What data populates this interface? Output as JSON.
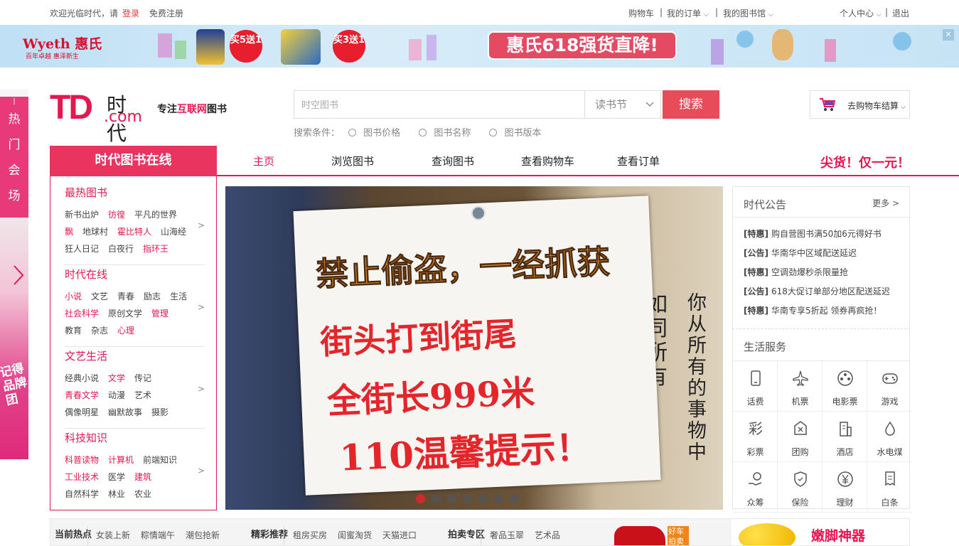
{
  "topbar": {
    "welcome": "欢迎光临时代，请",
    "login": "登录",
    "register": "免费注册",
    "cart": "购物车",
    "orders": "我的订单",
    "library": "我的图书馆",
    "user_center": "个人中心",
    "logout": "退出"
  },
  "banner": {
    "brand": "Wyeth 惠氏",
    "brand_sub": "百年卓越 惠泽新生",
    "promo1": "买5送1",
    "promo2": "买3送1",
    "slogan": "惠氏618强货直降!",
    "close": "✕"
  },
  "logo": {
    "td": "TD",
    "shidai": "时代",
    "com": ".com",
    "tag_prefix": "专注",
    "tag_highlight": "互联网",
    "tag_suffix": "图书"
  },
  "search": {
    "placeholder": "时空图书",
    "select_value": "读书节",
    "button": "搜索",
    "conditions_label": "搜索条件：",
    "options": [
      "图书价格",
      "图书名称",
      "图书版本"
    ]
  },
  "cart_button": {
    "label": "去购物车结算"
  },
  "ribbon": {
    "words": [
      "热",
      "门",
      "会",
      "场"
    ],
    "promo": "记得 品牌团"
  },
  "nav": {
    "header": "时代图书在线",
    "items": [
      "主页",
      "浏览图书",
      "查询图书",
      "查看购物车",
      "查看订单"
    ],
    "hot": "尖货！仅一元！"
  },
  "categories": [
    {
      "title": "最热图书",
      "rows": [
        [
          {
            "t": "新书出炉",
            "red": false
          },
          {
            "t": "彷徨",
            "red": true
          },
          {
            "t": "平凡的世界",
            "red": false
          }
        ],
        [
          {
            "t": "飘",
            "red": true
          },
          {
            "t": "地球村",
            "red": false
          },
          {
            "t": "霍比特人",
            "red": true
          },
          {
            "t": "山海经",
            "red": false
          }
        ],
        [
          {
            "t": "狂人日记",
            "red": false
          },
          {
            "t": "白夜行",
            "red": false
          },
          {
            "t": "指环王",
            "red": true
          }
        ]
      ]
    },
    {
      "title": "时代在线",
      "rows": [
        [
          {
            "t": "小说",
            "red": true
          },
          {
            "t": "文艺",
            "red": false
          },
          {
            "t": "青春",
            "red": false
          },
          {
            "t": "励志",
            "red": false
          },
          {
            "t": "生活",
            "red": false
          }
        ],
        [
          {
            "t": "社会科学",
            "red": true
          },
          {
            "t": "原创文学",
            "red": false
          },
          {
            "t": "管理",
            "red": true
          }
        ],
        [
          {
            "t": "教育",
            "red": false
          },
          {
            "t": "杂志",
            "red": false
          },
          {
            "t": "心理",
            "red": true
          }
        ]
      ]
    },
    {
      "title": "文艺生活",
      "rows": [
        [
          {
            "t": "经典小说",
            "red": false
          },
          {
            "t": "文学",
            "red": true
          },
          {
            "t": "传记",
            "red": false
          }
        ],
        [
          {
            "t": "青春文学",
            "red": true
          },
          {
            "t": "动漫",
            "red": false
          },
          {
            "t": "艺术",
            "red": false
          }
        ],
        [
          {
            "t": "偶像明星",
            "red": false
          },
          {
            "t": "幽默故事",
            "red": false
          },
          {
            "t": "摄影",
            "red": false
          }
        ]
      ]
    },
    {
      "title": "科技知识",
      "rows": [
        [
          {
            "t": "科普读物",
            "red": true
          },
          {
            "t": "计算机",
            "red": true
          },
          {
            "t": "前端知识",
            "red": false
          }
        ],
        [
          {
            "t": "工业技术",
            "red": true
          },
          {
            "t": "医学",
            "red": false
          },
          {
            "t": "建筑",
            "red": true
          }
        ],
        [
          {
            "t": "自然科学",
            "red": false
          },
          {
            "t": "林业",
            "red": false
          },
          {
            "t": "农业",
            "red": false
          }
        ]
      ]
    }
  ],
  "carousel": {
    "line1": "禁止偷盗，一经抓获",
    "line2": "街头打到街尾",
    "line3": "全街长999米",
    "line4": "110温馨提示！",
    "vert1": "如同所有",
    "vert2": "你从所有的事物中",
    "dots": 7,
    "active_dot": 0
  },
  "notice": {
    "title": "时代公告",
    "more": "更多 >",
    "items": [
      {
        "tag": "[特惠]",
        "text": "购自营图书满50加6元得好书"
      },
      {
        "tag": "[公告]",
        "text": "华南华中区域配送延迟"
      },
      {
        "tag": "[特惠]",
        "text": "空调劲爆秒杀限量抢"
      },
      {
        "tag": "[公告]",
        "text": "618大促订单部分地区配送延迟"
      },
      {
        "tag": "[特惠]",
        "text": "华南专享5折起 领券再疯抢！"
      }
    ]
  },
  "services": {
    "title": "生活服务",
    "items": [
      {
        "label": "话费",
        "icon": "phone-icon"
      },
      {
        "label": "机票",
        "icon": "plane-icon"
      },
      {
        "label": "电影票",
        "icon": "film-icon"
      },
      {
        "label": "游戏",
        "icon": "gamepad-icon"
      },
      {
        "label": "彩票",
        "icon": "lottery-icon"
      },
      {
        "label": "团购",
        "icon": "group-buy-icon"
      },
      {
        "label": "酒店",
        "icon": "hotel-icon"
      },
      {
        "label": "水电煤",
        "icon": "water-drop-icon"
      },
      {
        "label": "众筹",
        "icon": "crowdfund-icon"
      },
      {
        "label": "保险",
        "icon": "shield-icon"
      },
      {
        "label": "理财",
        "icon": "yuan-icon"
      },
      {
        "label": "白条",
        "icon": "receipt-icon"
      }
    ]
  },
  "strip": {
    "h1": "当前热点",
    "h1_items": [
      "女装上新",
      "粽情端午",
      "潮包抢新"
    ],
    "h2": "精彩推荐",
    "h2_items": [
      "租房买房",
      "闺蜜淘货",
      "天猫进口"
    ],
    "h3": "拍卖专区",
    "h3_items": [
      "奢品玉翠",
      "艺术品"
    ],
    "car_tag": "好车拍卖",
    "ad_text": "嫩脚神器"
  },
  "colors": {
    "brand": "#e4184f",
    "nav_head": "#e8345f",
    "search_btn": "#e84c59"
  }
}
